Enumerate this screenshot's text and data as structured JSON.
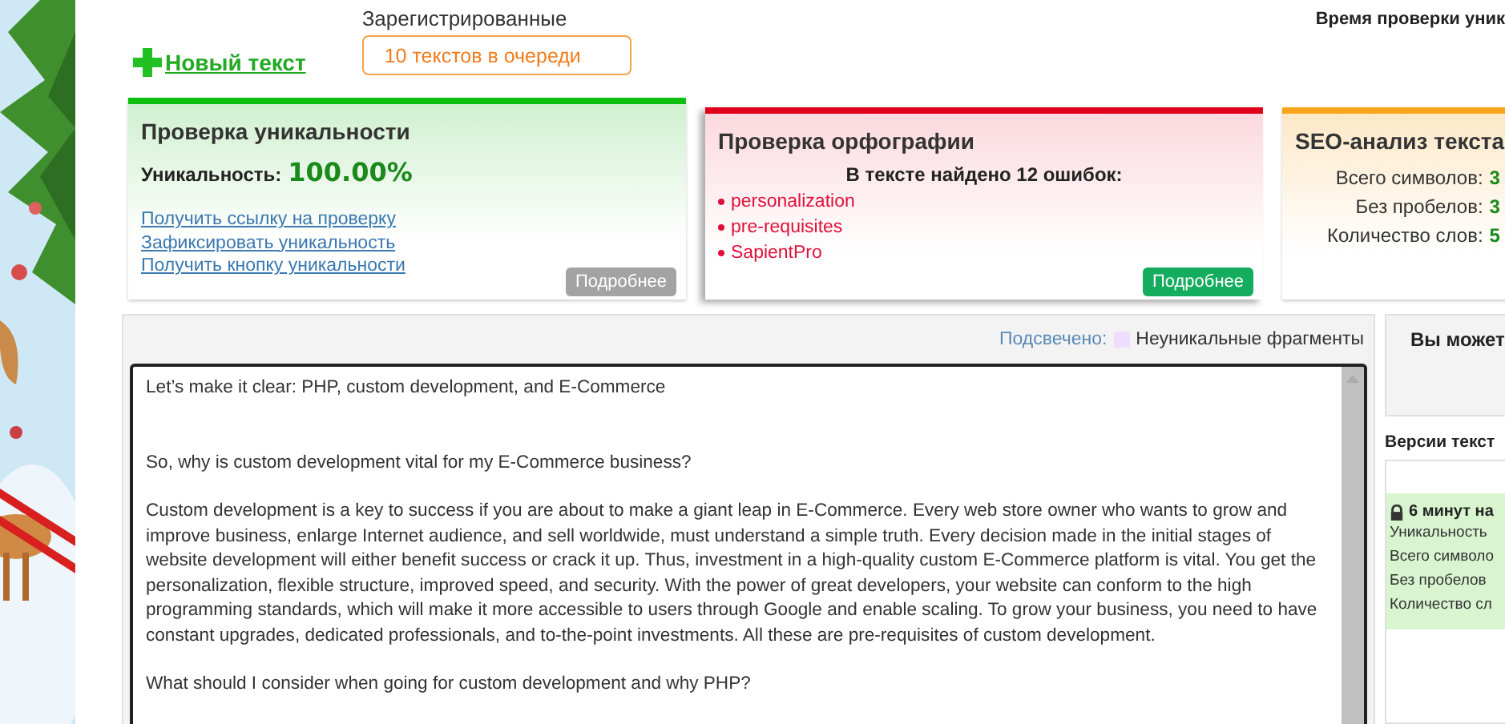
{
  "header": {
    "new_text": "Новый текст",
    "queue_label": "Зарегистрированные",
    "queue_button": "10 текстов в очереди",
    "check_time": "Время проверки уник"
  },
  "cards": [
    {
      "kind": "uniqueness",
      "title": "Проверка уникальности",
      "score_label": "Уникальность:",
      "score": "100.00%",
      "links": [
        "Получить ссылку на проверку",
        "Зафиксировать уникальность",
        "Получить кнопку уникальности"
      ],
      "more": "Подробнее"
    },
    {
      "kind": "spelling",
      "title": "Проверка орфографии",
      "summary": "В тексте найдено 12 ошибок:",
      "errors": [
        "personalization",
        "pre-requisites",
        "SapientPro"
      ],
      "more": "Подробнее"
    },
    {
      "kind": "seo",
      "title": "SEO-анализ текста",
      "stats": [
        {
          "label": "Всего символов:",
          "value": "3"
        },
        {
          "label": "Без пробелов:",
          "value": "3"
        },
        {
          "label": "Количество слов:",
          "value": "5"
        }
      ]
    }
  ],
  "editor": {
    "legend_label": "Подсвечено:",
    "legend_text": "Неуникальные фрагменты",
    "paragraphs": [
      "Let’s make it clear: PHP, custom development, and E-Commerce",
      "So, why is custom development vital for my E-Commerce business?",
      "Custom development is a key to success if you are about to make a giant leap in E-Commerce. Every web store owner who wants to grow and improve business, enlarge Internet audience, and sell worldwide, must understand a simple truth. Every decision made in the initial stages of website development will either benefit success or crack it up. Thus, investment in a high-quality custom E-Commerce platform is vital. You get the personalization, flexible structure, improved speed, and security. With the power of great developers, your website can conform to the high programming standards, which will make it more accessible to users through Google and enable scaling. To grow your business, you need to have constant upgrades, dedicated professionals, and to-the-point investments. All these are pre-requisites of custom development.",
      "What should I consider when going for custom development and why PHP?"
    ]
  },
  "sidebar": {
    "notice": "Вы может",
    "versions_title": "Версии текст",
    "version": {
      "locked": true,
      "time": "6 минут на",
      "rows": [
        "Уникальность",
        "Всего символо",
        "Без пробелов",
        "Количество сл"
      ]
    }
  }
}
